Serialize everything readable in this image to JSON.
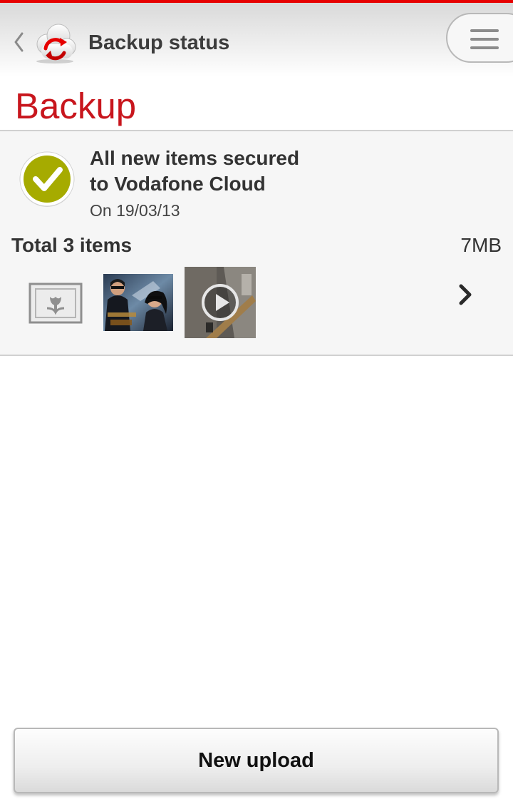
{
  "colors": {
    "brand_red": "#e60000",
    "heading_red": "#c8161d",
    "success_green": "#a6ab00"
  },
  "header": {
    "back_icon": "chevron-left-icon",
    "logo_icon": "cloud-sync-logo",
    "title": "Backup status",
    "menu_icon": "hamburger-menu-icon"
  },
  "page": {
    "heading": "Backup"
  },
  "backup_card": {
    "status_icon": "checkmark-circle-icon",
    "message_line1": "All new items secured",
    "message_line2": "to Vodafone Cloud",
    "date": "On 19/03/13",
    "total_label": "Total 3 items",
    "total_size": "7MB",
    "thumbnails": [
      {
        "type": "image-placeholder",
        "icon": "picture-placeholder-icon"
      },
      {
        "type": "photo"
      },
      {
        "type": "video",
        "icon": "play-icon"
      }
    ],
    "more_icon": "chevron-right-icon"
  },
  "footer": {
    "new_upload_label": "New upload"
  }
}
